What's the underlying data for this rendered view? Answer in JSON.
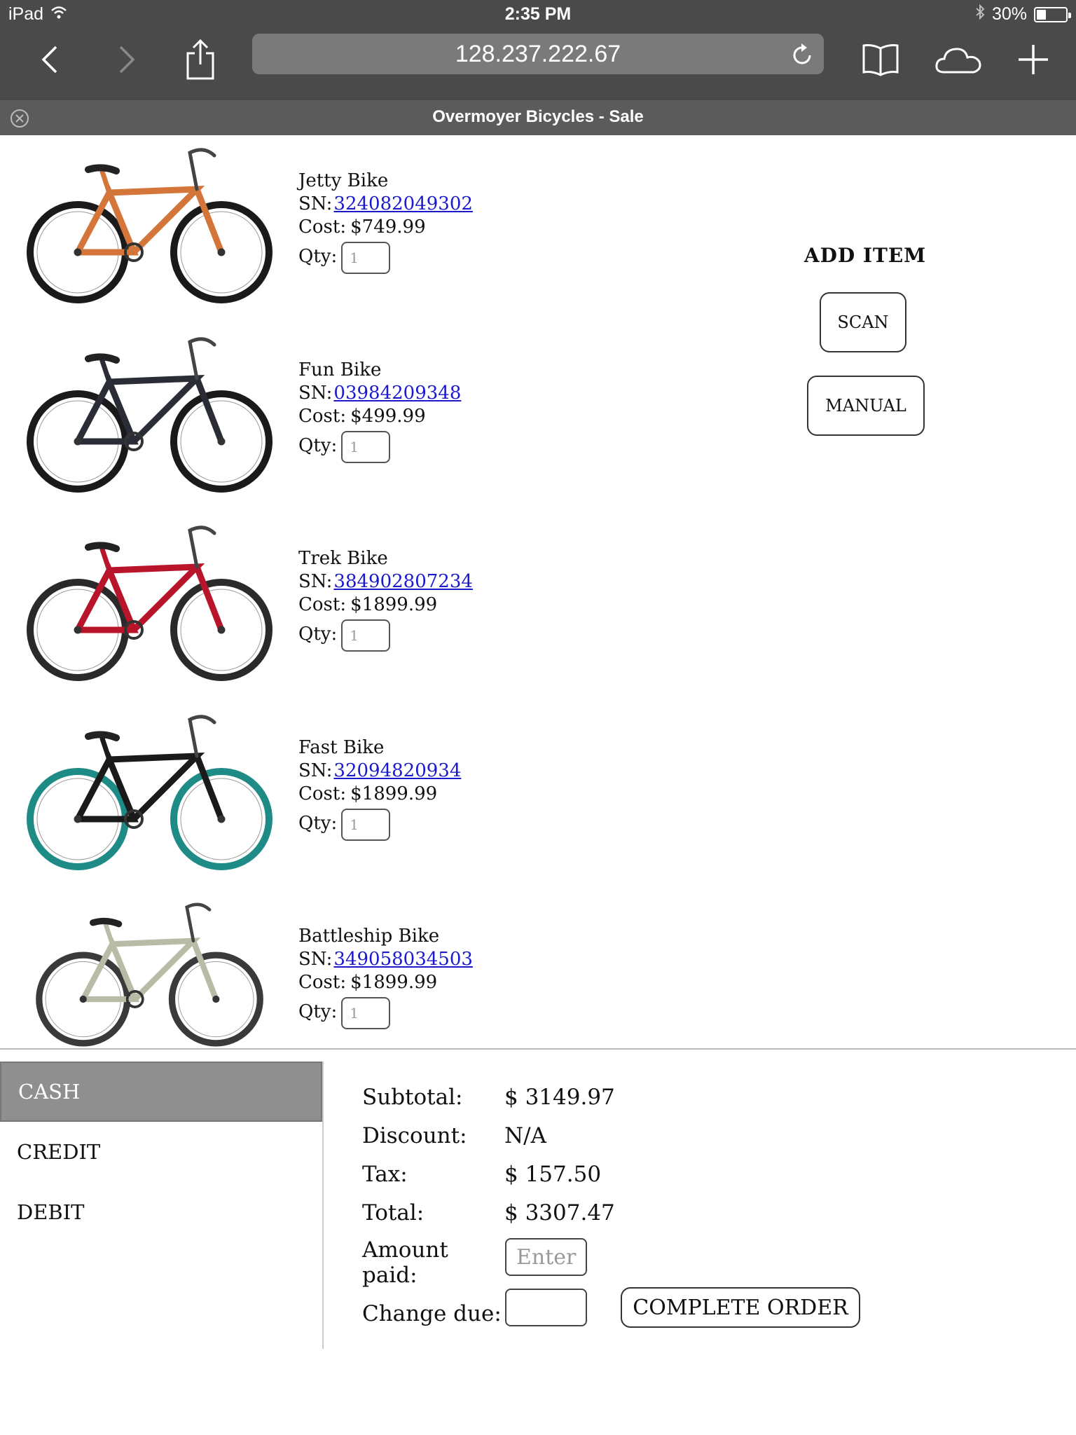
{
  "status_bar": {
    "device": "iPad",
    "time": "2:35 PM",
    "battery_label": "30%",
    "battery_level": 0.3
  },
  "toolbar": {
    "url": "128.237.222.67",
    "icons": [
      "back-icon",
      "forward-icon",
      "share-icon",
      "reload-icon",
      "bookmarks-icon",
      "cloud-tabs-icon",
      "new-tab-icon"
    ]
  },
  "tab": {
    "title": "Overmoyer Bicycles - Sale"
  },
  "labels": {
    "sn": "SN:",
    "cost": "Cost:",
    "qty": "Qty:"
  },
  "products": [
    {
      "name": "Jetty Bike",
      "sn": "324082049302",
      "cost": "$749.99",
      "qty": "1",
      "color": "#d4763a",
      "tire": "#1a1a1a"
    },
    {
      "name": "Fun Bike",
      "sn": "03984209348",
      "cost": "$499.99",
      "qty": "1",
      "color": "#2a2d35",
      "tire": "#1a1a1a"
    },
    {
      "name": "Trek Bike",
      "sn": "384902807234",
      "cost": "$1899.99",
      "qty": "1",
      "color": "#b8152a",
      "tire": "#2a2a2a"
    },
    {
      "name": "Fast Bike",
      "sn": "32094820934",
      "cost": "$1899.99",
      "qty": "1",
      "color": "#1a1a1a",
      "tire": "#1f8b86"
    },
    {
      "name": "Battleship Bike",
      "sn": "349058034503",
      "cost": "$1899.99",
      "qty": "1",
      "color": "#b9bba6",
      "tire": "#3a3a3a"
    }
  ],
  "add_item": {
    "heading": "ADD ITEM",
    "scan": "SCAN",
    "manual": "MANUAL"
  },
  "payment": {
    "methods": [
      "CASH",
      "CREDIT",
      "DEBIT"
    ],
    "active_method": "CASH"
  },
  "totals": {
    "subtotal_label": "Subtotal:",
    "subtotal": "$ 3149.97",
    "discount_label": "Discount:",
    "discount": "N/A",
    "tax_label": "Tax:",
    "tax": "$ 157.50",
    "total_label": "Total:",
    "total": "$ 3307.47",
    "amount_paid_label": "Amount paid:",
    "amount_paid_placeholder": "Enter",
    "change_due_label": "Change due:",
    "change_due": "",
    "complete_order": "COMPLETE ORDER"
  }
}
